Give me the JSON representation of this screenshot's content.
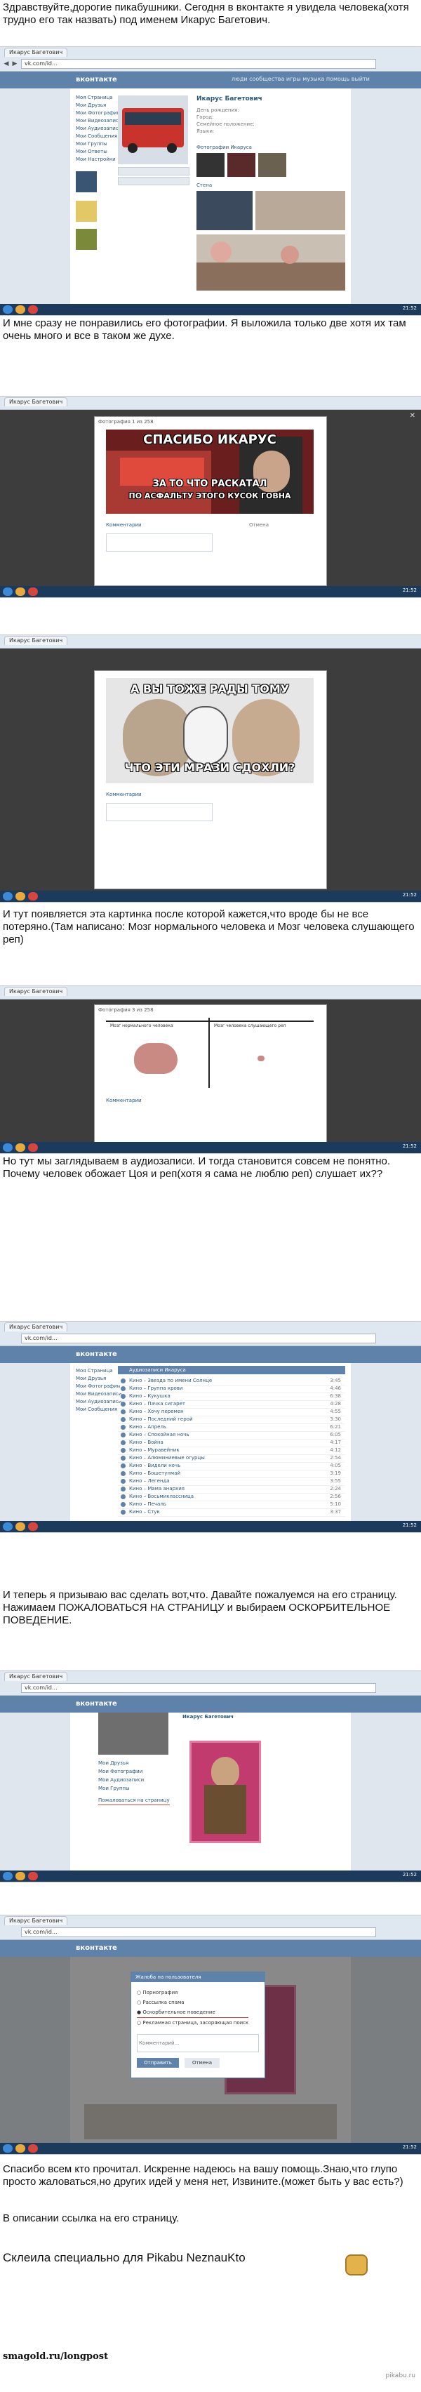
{
  "texts": {
    "intro": "Здравствуйте,дорогие пикабушники. Сегодня в вконтакте я увидела человека(хотя трудно его так назвать) под именем Икарус Багетович.",
    "photos": "И мне сразу не понравились его фотографии. Я выложила только две хотя их там очень много и все в таком же духе.",
    "brain_pic": "И тут появляется эта картинка после которой кажется,что вроде бы не все потеряно.(Там написано: Мозг нормального человека и Мозг человека слушающего реп)",
    "audio": "Но тут мы заглядываем в аудиозаписи. И тогда становится совсем не понятно. Почему человек обожает Цоя и реп(хотя я сама не люблю реп) слушает их??",
    "call": "И теперь я призываю вас сделать вот,что. Давайте пожалуемся на его страницу. Нажимаем ПОЖАЛОВАТЬСЯ НА СТРАНИЦУ и выбираем ОСКОРБИТЕЛЬНОЕ ПОВЕДЕНИЕ.",
    "thanks": "Спасибо всем кто прочитал. Искренне надеюсь на вашу помощь.Знаю,что глупо просто жаловаться,но других идей у меня нет, Извините.(может быть у вас есть?)",
    "link_note": "В описании ссылка на его страницу.",
    "made_for": "Склеила специально для Pikabu NeznauKto"
  },
  "footer": {
    "source": "smagold.ru/longpost",
    "watermark": "pikabu.ru"
  },
  "browser": {
    "tab_label": "Икарус Багетович",
    "address": "vk.com/id...",
    "vk_logo": "вконтакте",
    "vk_nav": "люди   сообщества   игры   музыка   помощь   выйти"
  },
  "vk_menu": [
    "Моя Страница",
    "Мои Друзья",
    "Мои Фотографии",
    "Мои Видеозаписи",
    "Мои Аудиозаписи",
    "Мои Сообщения",
    "Мои Группы",
    "Мои Ответы",
    "Мои Настройки"
  ],
  "profile": {
    "name": "Икарус Багетович",
    "fields": [
      "День рождения:",
      "Город:",
      "Семейное положение:",
      "Языки:"
    ],
    "photos_label": "Фотографии Икаруса",
    "wall_label": "Стена"
  },
  "memes": {
    "meme1_top": "СПАСИБО ИКАРУС",
    "meme1_bottom1": "ЗА ТО ЧТО РАСКАТАЛ",
    "meme1_bottom2": "ПО АСФАЛЬТУ ЭТОГО КУСОК ГОВНА",
    "meme2_top": "А ВЫ ТОЖЕ РАДЫ ТОМУ",
    "meme2_bottom": "ЧТО ЭТИ МРАЗИ СДОХЛИ?"
  },
  "photo_viewer": {
    "title": "Фотография 1 из 258",
    "comments": "Комментарии",
    "close": "Закрыть"
  },
  "brain": {
    "title": "Фотография 3 из 258",
    "left_caption": "Мозг нормального человека",
    "right_caption": "Мозг человека слушающего реп"
  },
  "audio": {
    "header": "Аудиозаписи Икаруса",
    "tracks": [
      {
        "title": "Кино – Звезда по имени Солнце",
        "time": "3:45"
      },
      {
        "title": "Кино – Группа крови",
        "time": "4:46"
      },
      {
        "title": "Кино – Кукушка",
        "time": "6:38"
      },
      {
        "title": "Кино – Пачка сигарет",
        "time": "4:28"
      },
      {
        "title": "Кино – Хочу перемен",
        "time": "4:55"
      },
      {
        "title": "Кино – Последний герой",
        "time": "3:30"
      },
      {
        "title": "Кино – Апрель",
        "time": "6:21"
      },
      {
        "title": "Кино – Спокойная ночь",
        "time": "6:05"
      },
      {
        "title": "Кино – Война",
        "time": "4:17"
      },
      {
        "title": "Кино – Муравейник",
        "time": "4:12"
      },
      {
        "title": "Кино – Алюминиевые огурцы",
        "time": "2:54"
      },
      {
        "title": "Кино – Видели ночь",
        "time": "4:05"
      },
      {
        "title": "Кино – Бошетунмай",
        "time": "3:19"
      },
      {
        "title": "Кино – Легенда",
        "time": "3:55"
      },
      {
        "title": "Кино – Мама анархия",
        "time": "2:24"
      },
      {
        "title": "Кино – Восьмиклассница",
        "time": "2:56"
      },
      {
        "title": "Кино – Печаль",
        "time": "5:10"
      },
      {
        "title": "Кино – Стук",
        "time": "3:37"
      }
    ]
  },
  "report": {
    "menu_item": "Пожаловаться на страницу",
    "dialog_title": "Жалоба на пользователя",
    "options": [
      "Порнография",
      "Рассылка спама",
      "Оскорбительное поведение",
      "Рекламная страница, засоряющая поиск"
    ],
    "comment_placeholder": "Комментарий...",
    "send": "Отправить",
    "cancel": "Отмена"
  },
  "taskbar": {
    "clock": "21:52"
  }
}
